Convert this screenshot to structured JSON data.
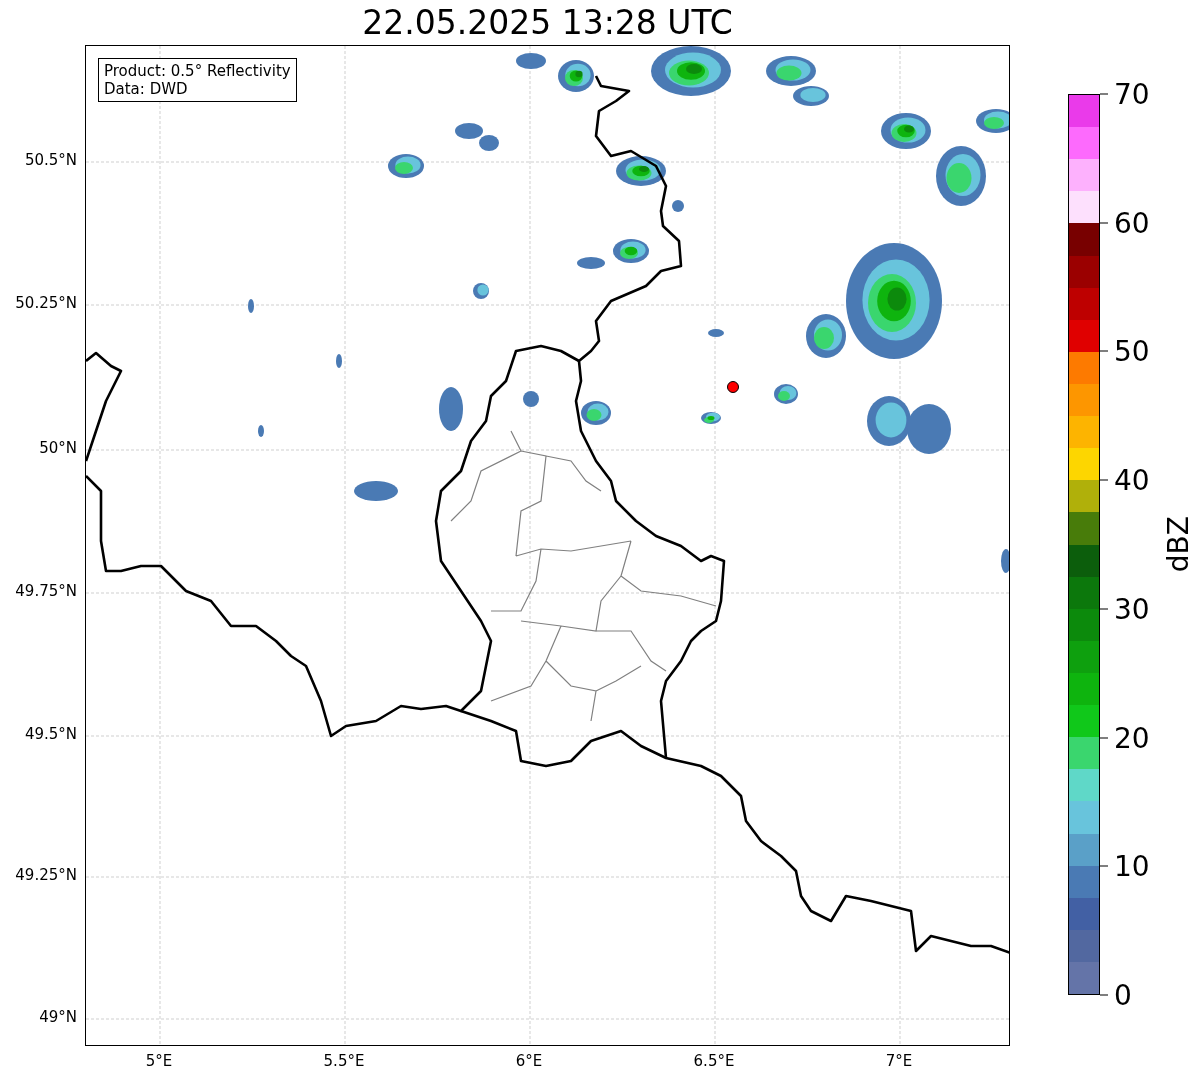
{
  "title": "22.05.2025 13:28 UTC",
  "info_box": [
    "Product: 0.5° Reflectivity",
    "Data: DWD"
  ],
  "y_ticks": [
    "50.5°N",
    "50.25°N",
    "50°N",
    "49.75°N",
    "49.5°N",
    "49.25°N",
    "49°N"
  ],
  "x_ticks": [
    "5°E",
    "5.5°E",
    "6°E",
    "6.5°E",
    "7°E"
  ],
  "colorbar": {
    "label": "dBZ",
    "ticks": [
      "70",
      "60",
      "50",
      "40",
      "30",
      "20",
      "10",
      "0"
    ],
    "segments": [
      {
        "color": "#ea3aea"
      },
      {
        "color": "#fd6afd"
      },
      {
        "color": "#fdb1fd"
      },
      {
        "color": "#fde0fd"
      },
      {
        "color": "#780000"
      },
      {
        "color": "#9b0000"
      },
      {
        "color": "#be0000"
      },
      {
        "color": "#e00000"
      },
      {
        "color": "#fd7a00"
      },
      {
        "color": "#fd9600"
      },
      {
        "color": "#fdb400"
      },
      {
        "color": "#fdd600"
      },
      {
        "color": "#b0b00a"
      },
      {
        "color": "#487c0a"
      },
      {
        "color": "#0c5e0c"
      },
      {
        "color": "#0c780c"
      },
      {
        "color": "#0c8a0c"
      },
      {
        "color": "#0ea00e"
      },
      {
        "color": "#0eb40e"
      },
      {
        "color": "#10c81a"
      },
      {
        "color": "#3ad66e"
      },
      {
        "color": "#5fd8c8"
      },
      {
        "color": "#68c4dc"
      },
      {
        "color": "#5aa0c8"
      },
      {
        "color": "#4a7ab4"
      },
      {
        "color": "#4260a4"
      },
      {
        "color": "#5268a0"
      },
      {
        "color": "#6474a8"
      }
    ]
  }
}
